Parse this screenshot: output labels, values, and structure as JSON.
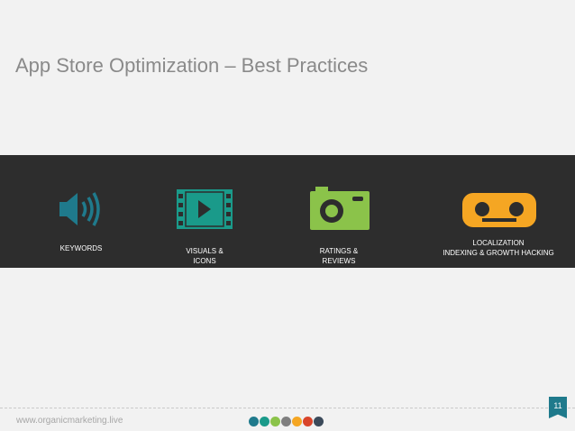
{
  "slide": {
    "title": "App Store Optimization – Best Practices",
    "footer_url": "www.organicmarketing.live",
    "page_number": "11"
  },
  "features": [
    {
      "label": "KEYWORDS",
      "icon": "speaker-icon",
      "color": "#1f7a8c"
    },
    {
      "label": "VISUALS &\nICONS",
      "icon": "video-icon",
      "color": "#1a9a8a"
    },
    {
      "label": "RATINGS &\nREVIEWS",
      "icon": "camera-icon",
      "color": "#8bc34a"
    },
    {
      "label": "LOCALIZATION\nINDEXING  & GROWTH HACKING",
      "icon": "voicemail-icon",
      "color": "#f5a623"
    }
  ],
  "colors": {
    "background": "#f2f2f2",
    "band": "#2d2d2d",
    "title_text": "#8a8a8a",
    "dots": [
      "#1f7a8c",
      "#1a9a8a",
      "#8bc34a",
      "#7f7f7f",
      "#f5a623",
      "#d9452b",
      "#3b4a5a"
    ]
  }
}
